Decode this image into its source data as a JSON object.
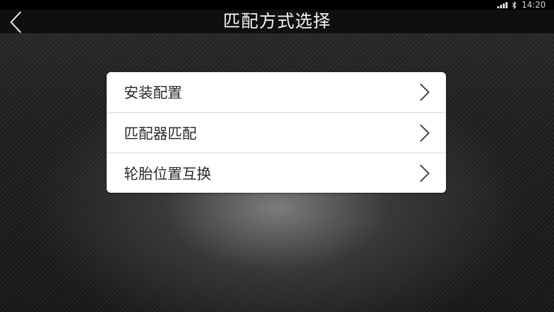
{
  "status_bar": {
    "time": "14:20",
    "icons": [
      "signal-icon",
      "bluetooth-icon"
    ]
  },
  "header": {
    "title": "匹配方式选择",
    "back_icon": "back-chevron-icon"
  },
  "menu": {
    "items": [
      {
        "label": "安装配置",
        "icon": "chevron-right-icon"
      },
      {
        "label": "匹配器匹配",
        "icon": "chevron-right-icon"
      },
      {
        "label": "轮胎位置互换",
        "icon": "chevron-right-icon"
      }
    ]
  },
  "colors": {
    "card_background": "#ffffff",
    "label_text": "#2b2b2b",
    "title_text": "#f2f2f2",
    "header_background": "#0f0f0f",
    "divider": "#d9d9d9"
  }
}
